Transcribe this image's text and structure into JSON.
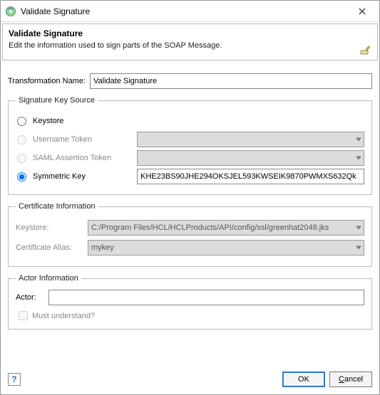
{
  "window": {
    "title": "Validate Signature"
  },
  "header": {
    "title": "Validate Signature",
    "description": "Edit the information used to sign parts of the SOAP Message."
  },
  "transformation": {
    "label": "Transformation Name:",
    "value": "Validate Signature"
  },
  "keysource": {
    "legend": "Signature Key Source",
    "options": {
      "keystore": {
        "label": "Keystore",
        "selected": false,
        "enabled": true
      },
      "username": {
        "label": "Username Token",
        "selected": false,
        "enabled": false,
        "value": ""
      },
      "saml": {
        "label": "SAML Assertion Token",
        "selected": false,
        "enabled": false,
        "value": ""
      },
      "symkey": {
        "label": "Symmetric Key",
        "selected": true,
        "enabled": true,
        "value": "KHE23BS90JHE294OKSJEL593KWSEIK9870PWMXS632Qk"
      }
    }
  },
  "cert": {
    "legend": "Certificate Information",
    "keystore_label": "Keystore:",
    "keystore_value": "C:/Program Files/HCL/HCLProducts/API/config/ssl/greenhat2048.jks",
    "alias_label": "Certificate Alias:",
    "alias_value": "mykey"
  },
  "actor": {
    "legend": "Actor Information",
    "label": "Actor:",
    "value": "",
    "must_understand_label": "Must understand?",
    "must_understand_checked": false
  },
  "footer": {
    "ok": "OK",
    "cancel": "Cancel"
  }
}
